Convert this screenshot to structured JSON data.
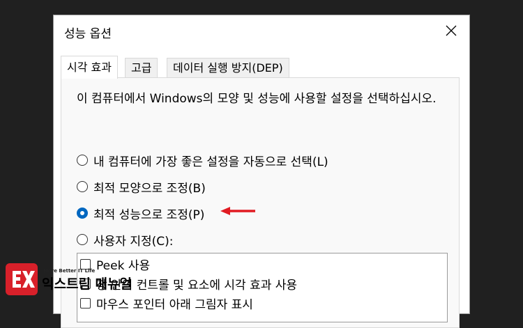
{
  "dialog": {
    "title": "성능 옵션",
    "close_icon": "close-icon"
  },
  "tabs": [
    {
      "label": "시각 효과",
      "active": true
    },
    {
      "label": "고급",
      "active": false
    },
    {
      "label": "데이터 실행 방지(DEP)",
      "active": false
    }
  ],
  "visual_effects": {
    "description": "이 컴퓨터에서 Windows의 모양 및 성능에 사용할 설정을 선택하십시오.",
    "options": [
      {
        "label": "내 컴퓨터에 가장 좋은 설정을 자동으로 선택(L)",
        "checked": false
      },
      {
        "label": "최적 모양으로 조정(B)",
        "checked": false
      },
      {
        "label": "최적 성능으로 조정(P)",
        "checked": true
      },
      {
        "label": "사용자 지정(C):",
        "checked": false
      }
    ],
    "custom_list": [
      {
        "label": "Peek 사용",
        "checked": false
      },
      {
        "label": "창 안의 컨트롤 및 요소에 시각 효과 사용",
        "checked": false
      },
      {
        "label": "마우스 포인터 아래 그림자 표시",
        "checked": false
      }
    ]
  },
  "annotation": {
    "arrow_color": "#e11b22"
  },
  "watermark": {
    "tagline": "More Better IT Life",
    "name": "익스트림 매뉴얼",
    "accent": "#d8202a"
  }
}
